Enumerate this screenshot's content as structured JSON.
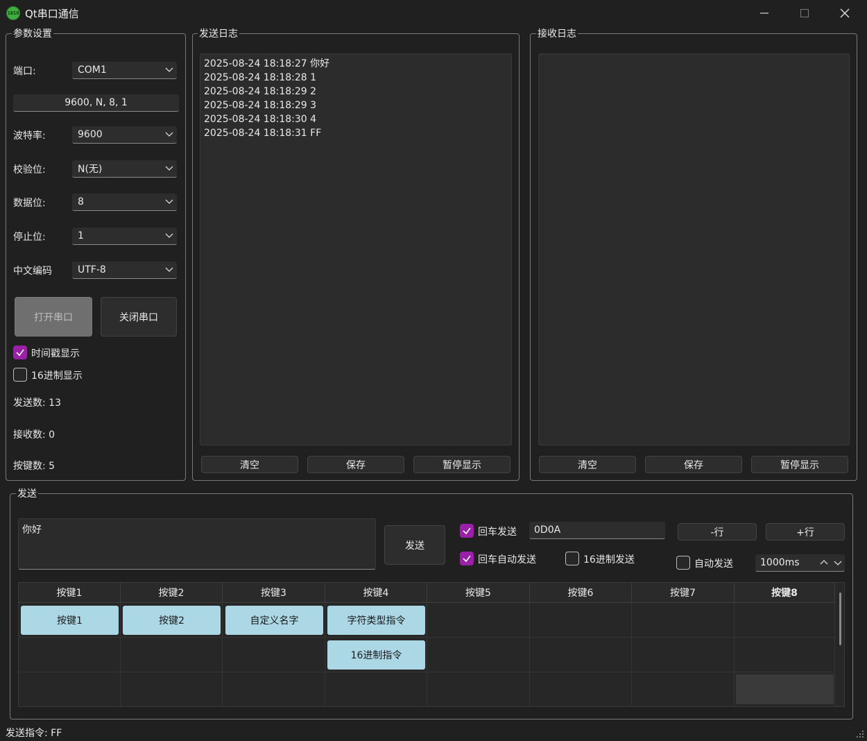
{
  "window": {
    "title": "Qt串口通信",
    "icon_text": "1010"
  },
  "params": {
    "group_title": "参数设置",
    "port_label": "端口:",
    "port_value": "COM1",
    "summary": "9600, N, 8, 1",
    "baud_label": "波特率:",
    "baud_value": "9600",
    "parity_label": "校验位:",
    "parity_value": "N(无)",
    "data_label": "数据位:",
    "data_value": "8",
    "stop_label": "停止位:",
    "stop_value": "1",
    "encoding_label": "中文编码",
    "encoding_value": "UTF-8",
    "open_button": "打开串口",
    "close_button": "关闭串口",
    "timestamp_label": "时间戳显示",
    "timestamp_checked": true,
    "hex_display_label": "16进制显示",
    "hex_display_checked": false,
    "sent_count": "发送数: 13",
    "recv_count": "接收数: 0",
    "key_count": "按键数: 5"
  },
  "send_log": {
    "group_title": "发送日志",
    "lines": [
      "2025-08-24 18:18:27 你好",
      "2025-08-24 18:18:28 1",
      "2025-08-24 18:18:29 2",
      "2025-08-24 18:18:29 3",
      "2025-08-24 18:18:30 4",
      "2025-08-24 18:18:31 FF"
    ],
    "clear_button": "清空",
    "save_button": "保存",
    "pause_button": "暂停显示"
  },
  "recv_log": {
    "group_title": "接收日志",
    "clear_button": "清空",
    "save_button": "保存",
    "pause_button": "暂停显示"
  },
  "send": {
    "group_title": "发送",
    "input_value": "你好",
    "send_button": "发送",
    "enter_send_label": "回车发送",
    "enter_send_checked": true,
    "terminator_value": "0D0A",
    "minus_row_button": "-行",
    "plus_row_button": "+行",
    "enter_auto_label": "回车自动发送",
    "enter_auto_checked": true,
    "hex_send_label": "16进制发送",
    "hex_send_checked": false,
    "auto_send_label": "自动发送",
    "auto_send_checked": false,
    "interval_value": "1000ms"
  },
  "keys": {
    "headers": [
      "按键1",
      "按键2",
      "按键3",
      "按键4",
      "按键5",
      "按键6",
      "按键7",
      "按键8"
    ],
    "row1": [
      "按键1",
      "按键2",
      "自定义名字",
      "字符类型指令"
    ],
    "row2": [
      "16进制指令"
    ]
  },
  "status_bar": {
    "text": "发送指令: FF"
  },
  "colors": {
    "background": "#202020",
    "accent_check": "#9b1fa8",
    "key_button": "#acd8e6"
  }
}
